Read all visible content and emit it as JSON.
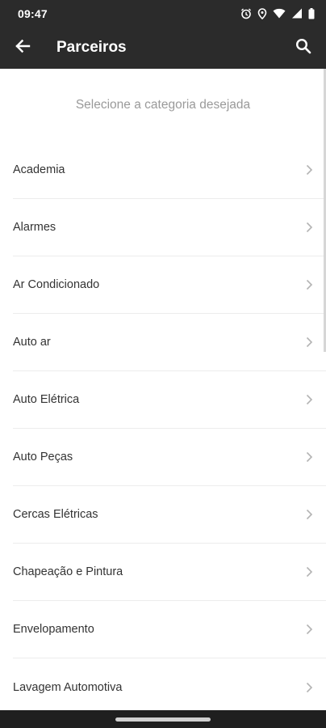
{
  "status_bar": {
    "time": "09:47",
    "icons": [
      "alarm-icon",
      "location-icon",
      "wifi-icon",
      "signal-icon",
      "battery-icon"
    ]
  },
  "app_bar": {
    "title": "Parceiros",
    "back_icon": "arrow-left-icon",
    "search_icon": "search-icon"
  },
  "main": {
    "subtitle": "Selecione a categoria desejada",
    "categories": [
      {
        "label": "Academia"
      },
      {
        "label": "Alarmes"
      },
      {
        "label": "Ar Condicionado"
      },
      {
        "label": "Auto ar"
      },
      {
        "label": "Auto Elétrica"
      },
      {
        "label": "Auto Peças"
      },
      {
        "label": "Cercas Elétricas"
      },
      {
        "label": "Chapeação e Pintura"
      },
      {
        "label": "Envelopamento"
      },
      {
        "label": "Lavagem Automotiva"
      }
    ]
  },
  "colors": {
    "bar_background": "#2b2b2b",
    "subtitle_text": "#9a9a9a",
    "item_text": "#333333",
    "divider": "#ececec"
  }
}
